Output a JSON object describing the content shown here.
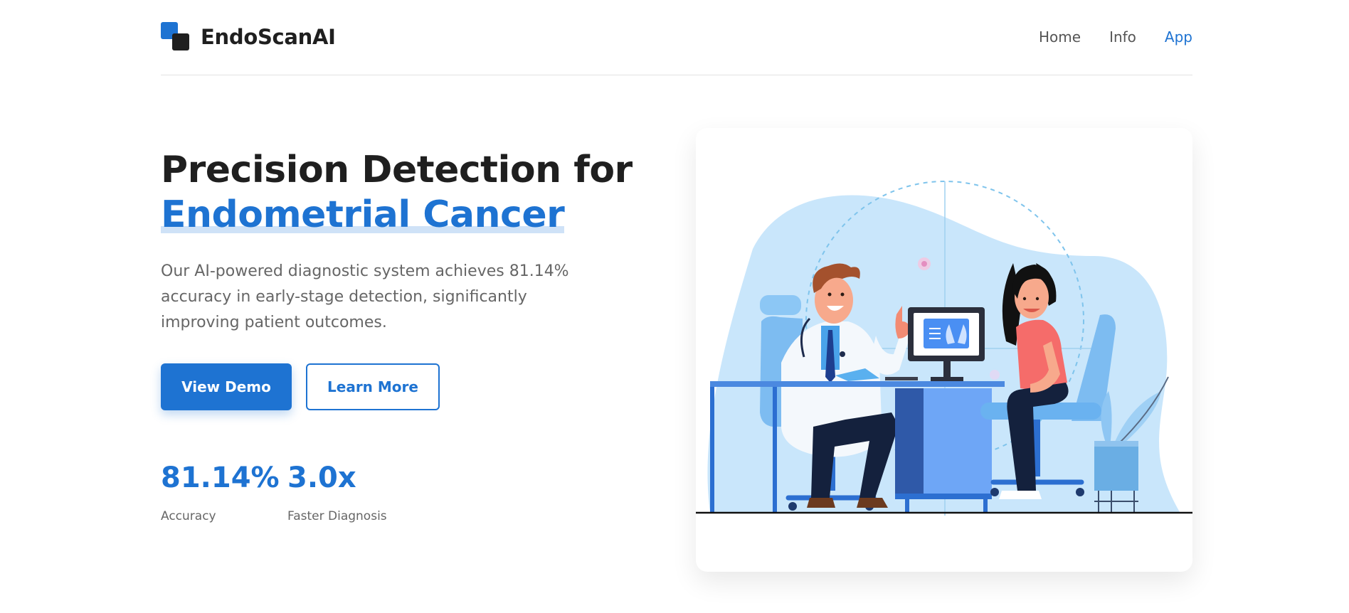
{
  "brand": {
    "name": "EndoScanAI"
  },
  "nav": {
    "items": [
      "Home",
      "Info",
      "App"
    ],
    "active": "App"
  },
  "hero": {
    "title_line1": "Precision Detection for",
    "title_line2": "Endometrial Cancer",
    "description": "Our AI-powered diagnostic system achieves 81.14% accuracy in early-stage detection, significantly improving patient outcomes.",
    "primary_button": "View Demo",
    "secondary_button": "Learn More"
  },
  "stats": [
    {
      "value": "81.14%",
      "label": "Accuracy"
    },
    {
      "value": "3.0x",
      "label": "Faster Diagnosis"
    }
  ],
  "colors": {
    "accent": "#1e73d2",
    "text": "#1f1f1f",
    "muted": "#666666",
    "illustration_bg": "#c9e6fb"
  }
}
